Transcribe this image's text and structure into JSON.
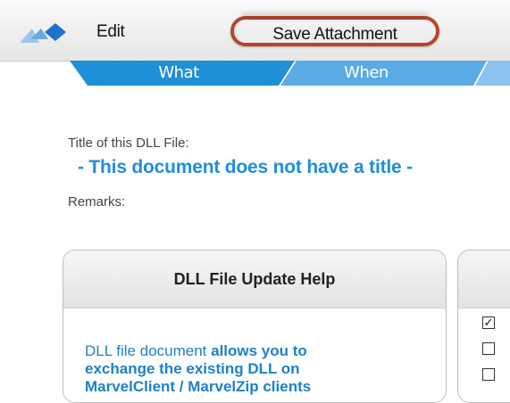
{
  "toolbar": {
    "edit_label": "Edit",
    "save_attachment_label": "Save Attachment",
    "highlight_color": "#b8452c"
  },
  "tabs": [
    {
      "label": "What",
      "color": "#1f8fd8"
    },
    {
      "label": "When",
      "color": "#4fa3e3"
    }
  ],
  "content": {
    "title_label": "Title of this DLL File:",
    "title_value": "- This document does not have a title -",
    "remarks_label": "Remarks:"
  },
  "help_panel": {
    "heading": "DLL File Update Help",
    "text_normal": "DLL file document ",
    "text_bold_1": "allows you to",
    "text_bold_2": "exchange the existing DLL on",
    "text_bold_3": "MarvelClient / MarvelZip clients"
  },
  "checkboxes": [
    {
      "checked": true,
      "glyph": "✓"
    },
    {
      "checked": false,
      "glyph": ""
    },
    {
      "checked": false,
      "glyph": ""
    }
  ]
}
